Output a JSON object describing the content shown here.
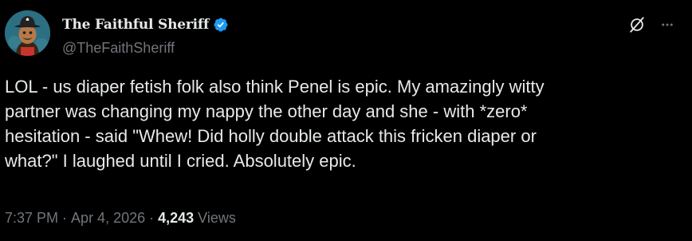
{
  "author": {
    "display_name": "The Faithful Sheriff",
    "handle": "@TheFaithSheriff",
    "verified": true
  },
  "tweet": {
    "text": "LOL - us diaper fetish folk also think Penel is epic. My amazingly witty\npartner was changing my nappy the other day and she - with *zero*\nhesitation - said \"Whew! Did holly double attack this fricken diaper or\nwhat?\" I laughed until I cried. Absolutely epic."
  },
  "meta": {
    "time": "7:37 PM",
    "separator": "·",
    "date": "Apr 4, 2026",
    "views_count": "4,243",
    "views_label": "Views"
  },
  "icons": {
    "verified": "verified-badge-icon",
    "grok": "grok-icon",
    "more": "more-options-icon"
  },
  "colors": {
    "background": "#000000",
    "text_primary": "#e7e9ea",
    "text_secondary": "#71767b",
    "verified_blue": "#1d9bf0"
  }
}
